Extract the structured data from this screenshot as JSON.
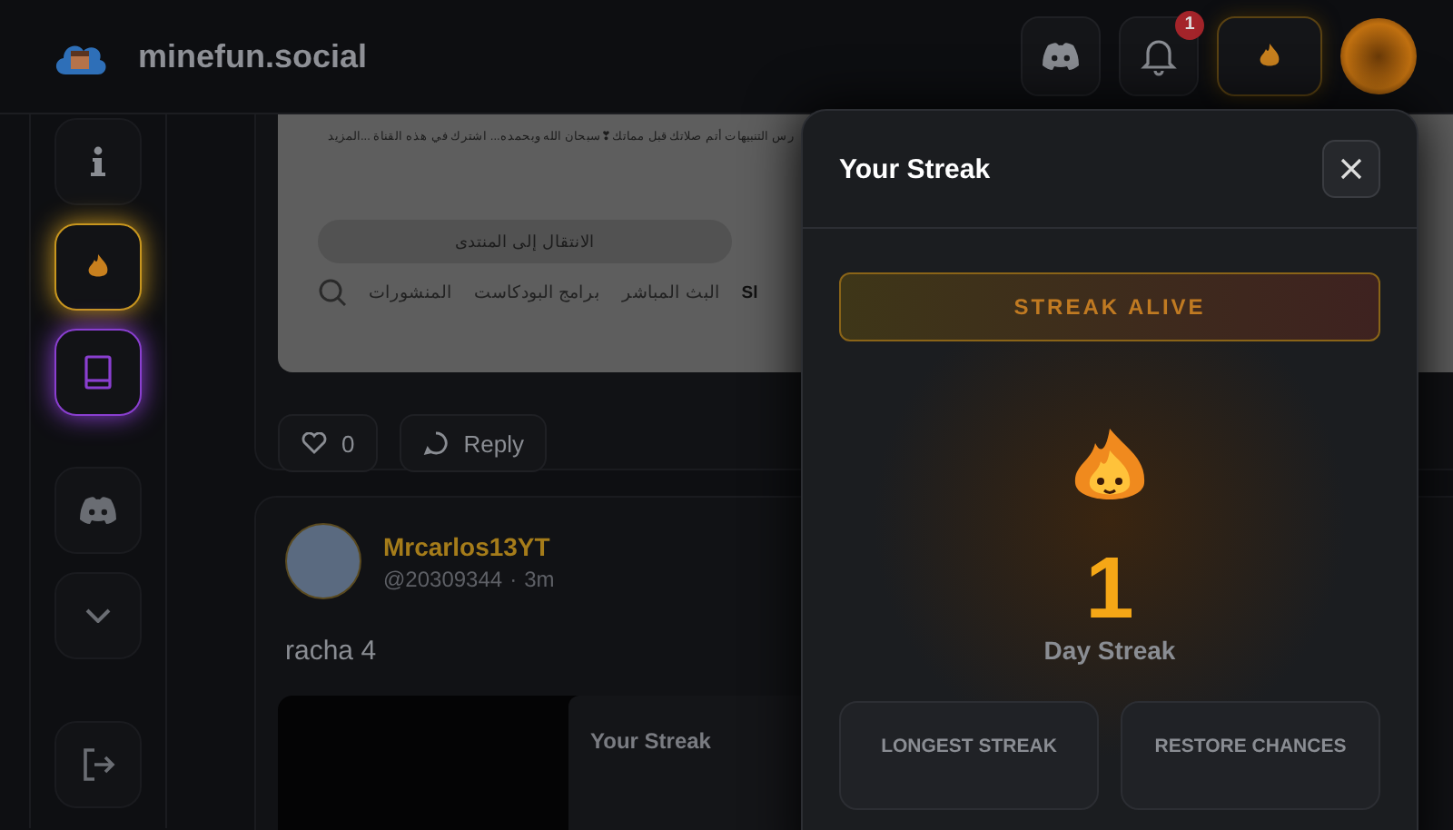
{
  "header": {
    "site_name": "minefun.social",
    "notification_count": "1"
  },
  "sidebar": {
    "items": [
      {
        "kind": "info"
      },
      {
        "kind": "flame",
        "color": "#c8961e"
      },
      {
        "kind": "book",
        "color": "#8a3fd0"
      },
      {
        "kind": "discord"
      },
      {
        "kind": "chevron"
      },
      {
        "kind": "logout"
      }
    ]
  },
  "posts": [
    {
      "kind": "embed",
      "embed": {
        "description": "رس التنبيهات   أتم صلاتك قبل مماتك❣سبحان الله وبحمده... اشترك في هذه القناة ...المزيد",
        "button": "الانتقال إلى المنتدى",
        "tabs": [
          "Sl",
          "البث المباشر",
          "برامج البودكاست",
          "المنشورات"
        ]
      },
      "likes": "0",
      "reply": "Reply"
    },
    {
      "kind": "text",
      "author": "Mrcarlos13YT",
      "handle": "@20309344",
      "separator": "·",
      "time": "3m",
      "body": "racha 4",
      "media_caption": "Your Streak"
    }
  ],
  "modal": {
    "title": "Your Streak",
    "status": "STREAK ALIVE",
    "count": "1",
    "count_label": "Day Streak",
    "longest_streak": {
      "label": "LONGEST STREAK"
    },
    "restore_chances": {
      "label": "RESTORE CHANCES"
    }
  }
}
